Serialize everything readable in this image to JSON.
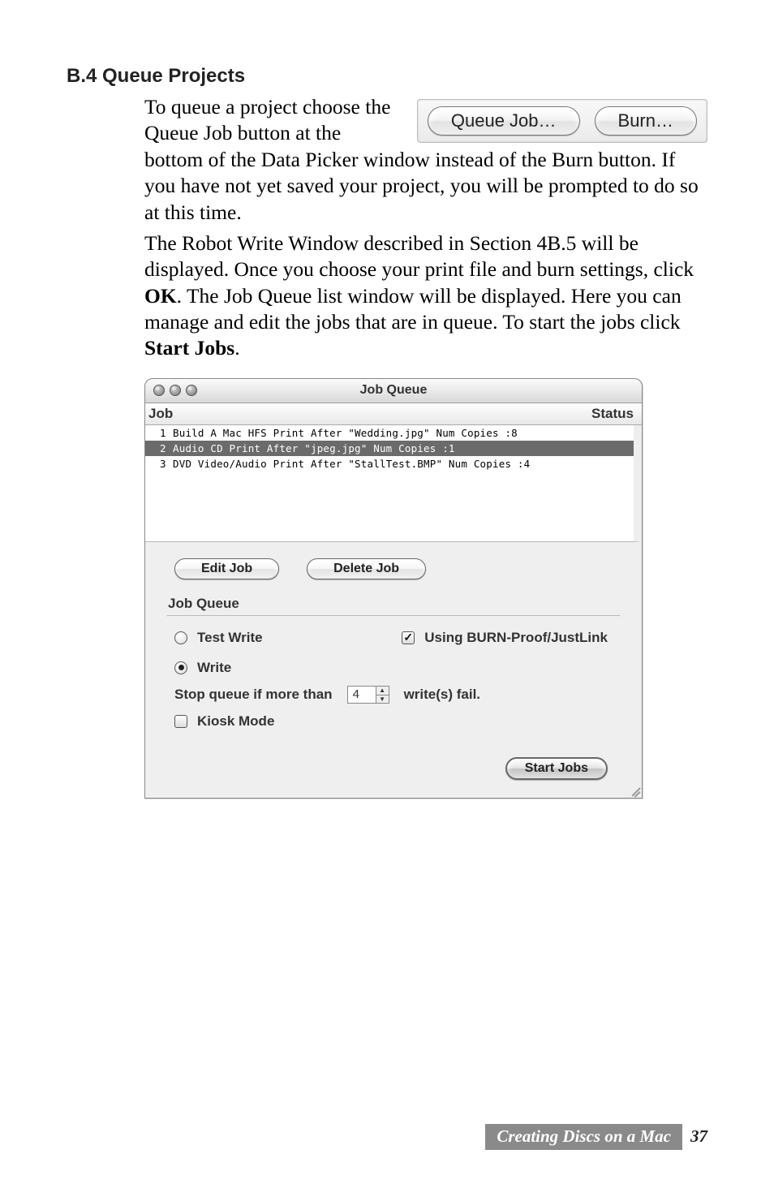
{
  "section": {
    "heading": "B.4 Queue Projects",
    "para1a": "To queue a project choose the Queue Job button at the bottom of the Data Picker window instead of the Burn button. If you have not yet saved your project, you will be prompted to do so at this time.",
    "para2_pre": "The Robot Write Window described in Section 4B.5 will be displayed. Once you choose your print file and burn settings, click ",
    "para2_ok": "OK",
    "para2_mid": ". The Job Queue list window will be displayed. Here you can manage and edit the jobs that are in queue. To start the jobs click ",
    "para2_start": "Start Jobs",
    "para2_end": "."
  },
  "topbuttons": {
    "queue": "Queue Job…",
    "burn": "Burn…"
  },
  "window": {
    "title": "Job Queue",
    "col_job": "Job",
    "col_status": "Status",
    "rows": [
      {
        "n": "1",
        "text": "Build A Mac HFS Print After \"Wedding.jpg\"  Num Copies :8"
      },
      {
        "n": "2",
        "text": "Audio CD Print After \"jpeg.jpg\"  Num Copies :1"
      },
      {
        "n": "3",
        "text": "DVD Video/Audio Print After \"StallTest.BMP\"  Num Copies :4"
      }
    ],
    "edit": "Edit Job",
    "delete": "Delete Job",
    "group_label": "Job Queue",
    "test_write": "Test Write",
    "write": "Write",
    "burn_proof": "Using BURN-Proof/JustLink",
    "stop_label": "Stop queue if more than",
    "stop_value": "4",
    "stop_suffix": "write(s) fail.",
    "kiosk": "Kiosk Mode",
    "start": "Start Jobs"
  },
  "footer": {
    "label": "Creating Discs on a Mac",
    "page": "37"
  }
}
